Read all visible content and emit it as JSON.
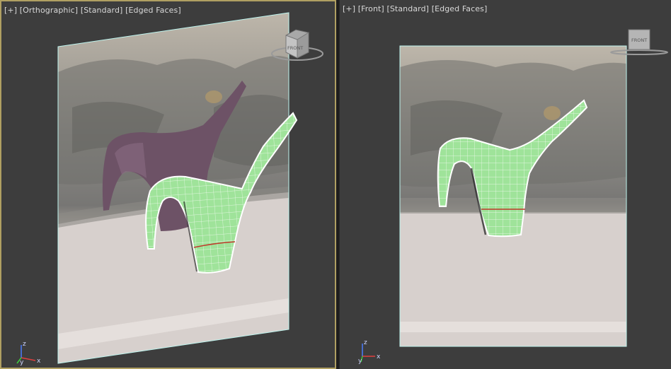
{
  "viewports": [
    {
      "id": "left",
      "label": {
        "plus": "[+]",
        "view": "[Orthographic]",
        "shading": "[Standard]",
        "mode": "[Edged Faces]"
      },
      "viewcube_face": "FRONT",
      "axes": {
        "x": "x",
        "y": "y",
        "z": "z"
      }
    },
    {
      "id": "right",
      "label": {
        "plus": "[+]",
        "view": "[Front]",
        "shading": "[Standard]",
        "mode": "[Edged Faces]"
      },
      "viewcube_face": "FRONT",
      "axes": {
        "x": "x",
        "y": "y",
        "z": "z"
      }
    }
  ],
  "colors": {
    "viewport_bg": "#3d3d3d",
    "active_border": "#b0a062",
    "mesh_fill": "#9fe39a",
    "mesh_edge": "#ffffff",
    "plane_edge": "#bff5ef",
    "seam": "#c0392b"
  }
}
